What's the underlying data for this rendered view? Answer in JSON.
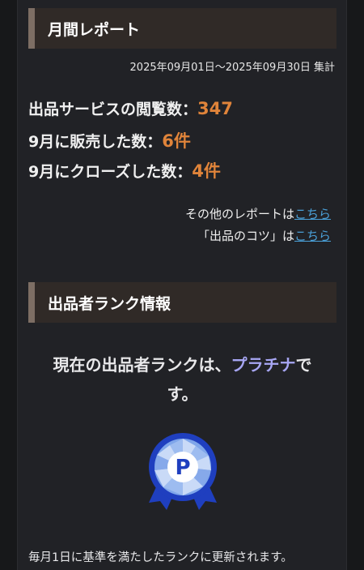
{
  "monthly_report": {
    "title": "月間レポート",
    "period": "2025年09月01日〜2025年09月30日 集計",
    "stats": [
      {
        "label": "出品サービスの閲覧数：",
        "value": "347"
      },
      {
        "label": "9月に販売した数：",
        "value": "6件"
      },
      {
        "label": "9月にクローズした数：",
        "value": "4件"
      }
    ],
    "other_reports": {
      "prefix": "その他のレポートは",
      "link": "こちら"
    },
    "tips": {
      "prefix": "「出品のコツ」は",
      "link": "こちら"
    }
  },
  "seller_rank": {
    "title": "出品者ランク情報",
    "text_before": "現在の出品者ランクは、",
    "rank_name": "プラチナ",
    "text_after_1": "で",
    "text_after_2": "す。",
    "badge_letter": "P",
    "badge_icon": "platinum-rank-medal-icon",
    "note": "毎月1日に基準を満たしたランクに更新されます。"
  },
  "colors": {
    "background": "#212226",
    "header_bg": "#302a27",
    "header_accent": "#7d6e64",
    "stat_value": "#e0843a",
    "link": "#4aa0d8",
    "rank": "#a7a6f3",
    "badge_blue": "#1f3fbf"
  }
}
